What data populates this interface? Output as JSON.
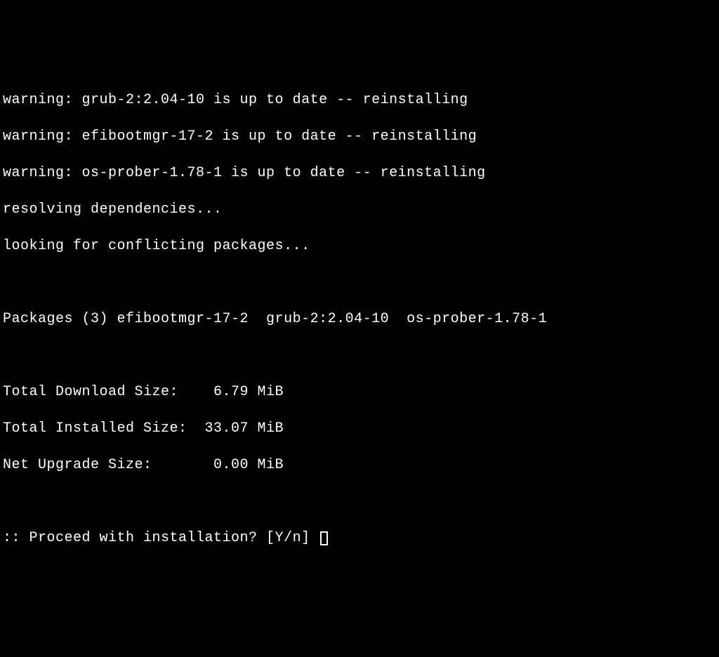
{
  "terminal": {
    "warnings": [
      "warning: grub-2:2.04-10 is up to date -- reinstalling",
      "warning: efibootmgr-17-2 is up to date -- reinstalling",
      "warning: os-prober-1.78-1 is up to date -- reinstalling"
    ],
    "resolving": "resolving dependencies...",
    "conflicting": "looking for conflicting packages...",
    "packages_line": "Packages (3) efibootmgr-17-2  grub-2:2.04-10  os-prober-1.78-1",
    "download_size": "Total Download Size:    6.79 MiB",
    "installed_size": "Total Installed Size:  33.07 MiB",
    "net_upgrade_size": "Net Upgrade Size:       0.00 MiB",
    "prompt": ":: Proceed with installation? [Y/n] "
  }
}
